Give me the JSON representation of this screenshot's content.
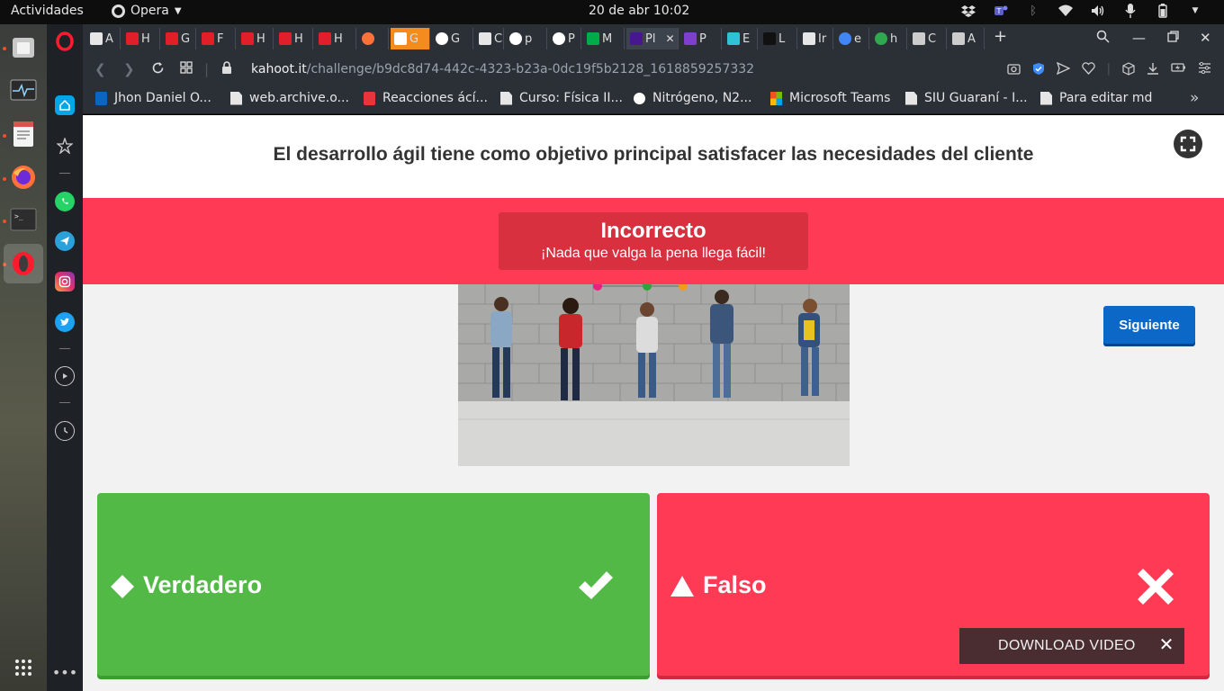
{
  "system": {
    "activities": "Actividades",
    "app_name": "Opera",
    "clock": "20 de abr  10:02"
  },
  "tabs": [
    {
      "label": "A",
      "favicon": "document-icon"
    },
    {
      "label": "H",
      "favicon": "huawei-icon"
    },
    {
      "label": "G",
      "favicon": "huawei-icon"
    },
    {
      "label": "F",
      "favicon": "huawei-icon"
    },
    {
      "label": "H",
      "favicon": "huawei-icon"
    },
    {
      "label": "H",
      "favicon": "huawei-icon"
    },
    {
      "label": "H",
      "favicon": "huawei-icon"
    },
    {
      "label": "",
      "favicon": "firefox-icon"
    },
    {
      "label": "G",
      "favicon": "mic-icon"
    },
    {
      "label": "G",
      "favicon": "github-icon"
    },
    {
      "label": "C",
      "favicon": "document-icon"
    },
    {
      "label": "p",
      "favicon": "wordpress-icon"
    },
    {
      "label": "P",
      "favicon": "wordpress-icon"
    },
    {
      "label": "M",
      "favicon": "meet-icon"
    },
    {
      "label": "Pl",
      "favicon": "kahoot-icon",
      "active": true
    },
    {
      "label": "P",
      "favicon": "kahoot-k-icon"
    },
    {
      "label": "E",
      "favicon": "edge-icon"
    },
    {
      "label": "L",
      "favicon": "obs-icon"
    },
    {
      "label": "Ir",
      "favicon": "document-icon"
    },
    {
      "label": "e",
      "favicon": "google-icon"
    },
    {
      "label": "h",
      "favicon": "green-icon"
    },
    {
      "label": "C",
      "favicon": "gear-icon"
    },
    {
      "label": "A",
      "favicon": "apps-icon"
    }
  ],
  "address": {
    "domain": "kahoot.it",
    "path": "/challenge/b9dc8d74-442c-4323-b23a-0dc19f5b2128_1618859257332"
  },
  "bookmarks": [
    {
      "label": "Jhon Daniel O...",
      "icon": "linkedin-icon"
    },
    {
      "label": "web.archive.o...",
      "icon": "document-icon"
    },
    {
      "label": "Reacciones ácí...",
      "icon": "red-square-icon"
    },
    {
      "label": "Curso: Física II...",
      "icon": "document-icon"
    },
    {
      "label": "Nitrógeno, N2...",
      "icon": "circle-icon"
    },
    {
      "label": "Microsoft Teams",
      "icon": "microsoft-icon"
    },
    {
      "label": "SIU Guaraní - I...",
      "icon": "document-icon"
    },
    {
      "label": "Para editar md",
      "icon": "document-icon"
    }
  ],
  "quiz": {
    "question": "El desarrollo ágil  tiene como objetivo principal satisfacer las necesidades del cliente",
    "result_title": "Incorrecto",
    "result_subtitle": "¡Nada que valga la pena llega fácil!",
    "next_label": "Siguiente",
    "answers": [
      {
        "label": "Verdadero",
        "shape": "diamond-icon",
        "correct": true,
        "color": "#53b946"
      },
      {
        "label": "Falso",
        "shape": "triangle-icon",
        "correct": false,
        "color": "#ff3a55"
      }
    ],
    "banner_color": "#ff3a55",
    "next_color": "#0c68c7"
  },
  "download": {
    "label": "DOWNLOAD VIDEO"
  }
}
